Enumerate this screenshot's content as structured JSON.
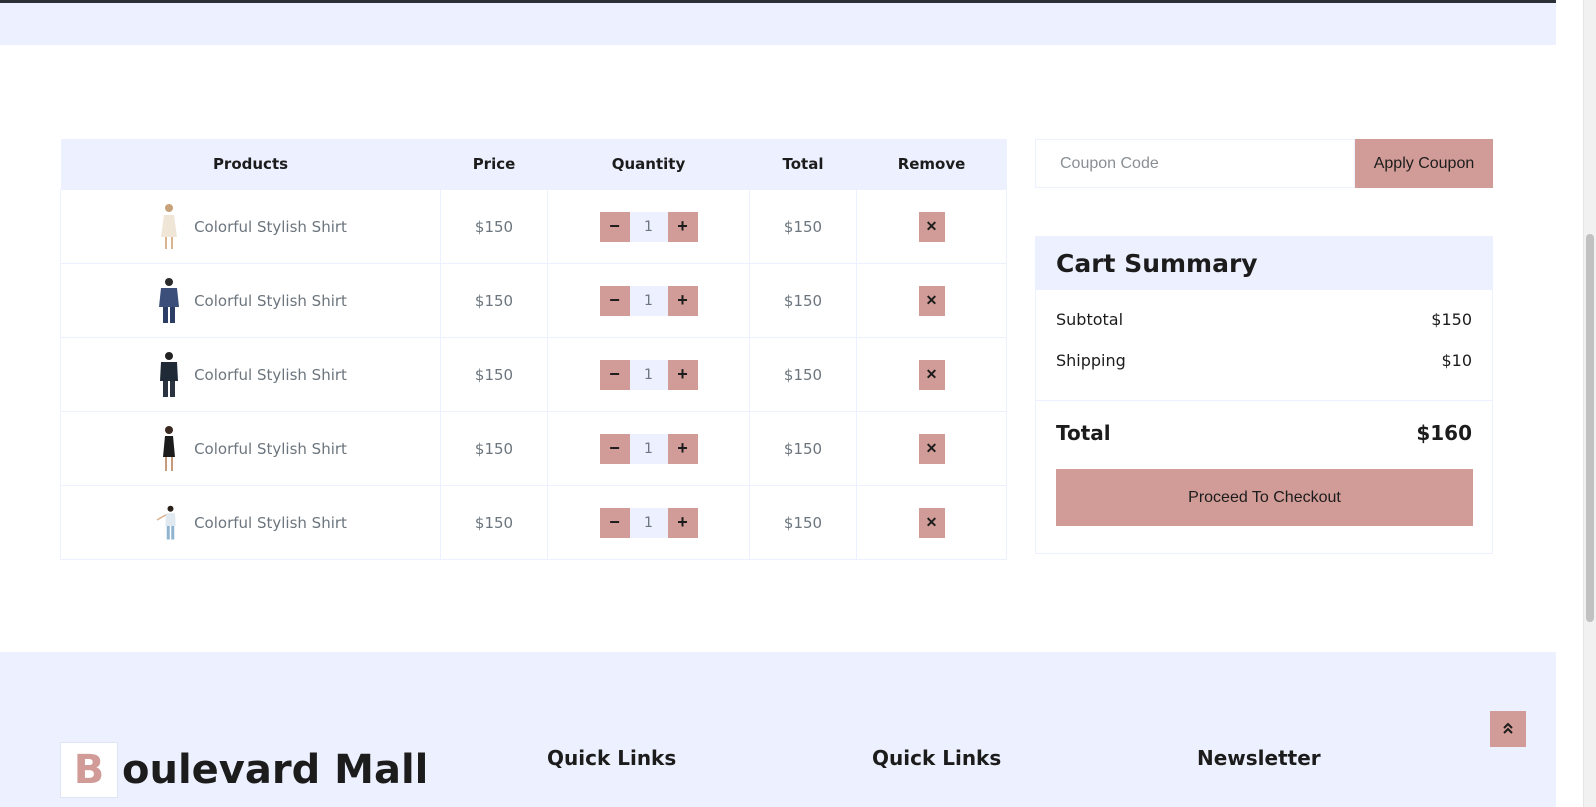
{
  "header": {},
  "cart": {
    "columns": [
      "Products",
      "Price",
      "Quantity",
      "Total",
      "Remove"
    ],
    "rows": [
      {
        "name": "Colorful Stylish Shirt",
        "price": "$150",
        "qty": "1",
        "total": "$150"
      },
      {
        "name": "Colorful Stylish Shirt",
        "price": "$150",
        "qty": "1",
        "total": "$150"
      },
      {
        "name": "Colorful Stylish Shirt",
        "price": "$150",
        "qty": "1",
        "total": "$150"
      },
      {
        "name": "Colorful Stylish Shirt",
        "price": "$150",
        "qty": "1",
        "total": "$150"
      },
      {
        "name": "Colorful Stylish Shirt",
        "price": "$150",
        "qty": "1",
        "total": "$150"
      }
    ],
    "minus_symbol": "−",
    "plus_symbol": "+",
    "remove_symbol": "✕"
  },
  "coupon": {
    "placeholder": "Coupon Code",
    "button_label": "Apply Coupon"
  },
  "summary": {
    "title": "Cart Summary",
    "subtotal_label": "Subtotal",
    "subtotal_value": "$150",
    "shipping_label": "Shipping",
    "shipping_value": "$10",
    "total_label": "Total",
    "total_value": "$160",
    "checkout_label": "Proceed To Checkout"
  },
  "footer": {
    "logo_letter": "B",
    "logo_text": "oulevard Mall",
    "col1_title": "Quick Links",
    "col2_title": "Quick Links",
    "col3_title": "Newsletter"
  },
  "colors": {
    "accent": "#D19C97",
    "light_bg": "#EDF1FF",
    "dark_text": "#1C1C1C"
  },
  "icons": {
    "back_to_top": "double-chevron-up-icon",
    "remove": "close-icon"
  }
}
